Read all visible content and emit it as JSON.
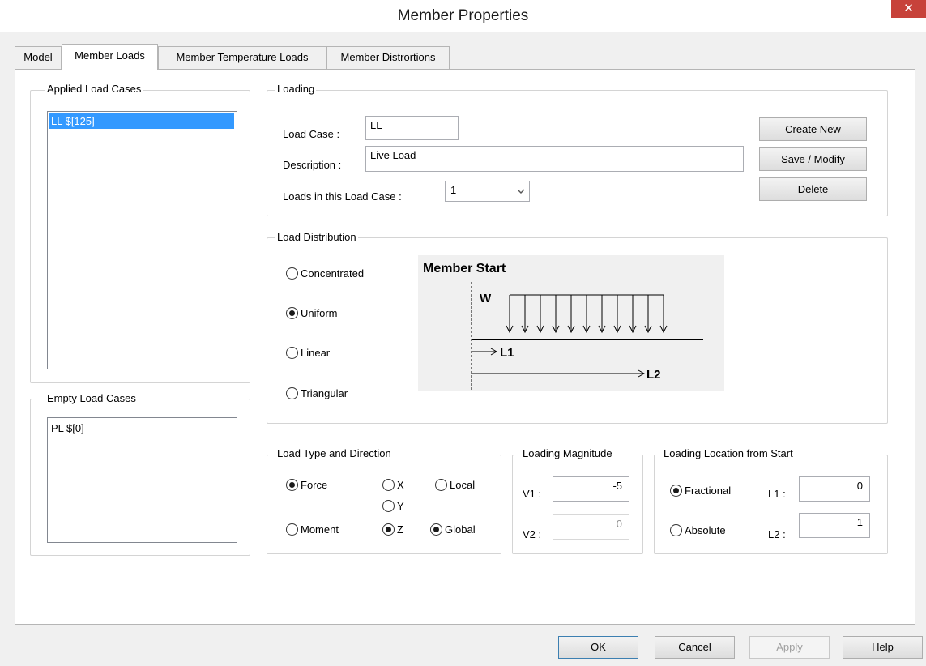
{
  "window": {
    "title": "Member Properties",
    "close_glyph": "✕"
  },
  "tabs": [
    {
      "label": "Model",
      "active": false
    },
    {
      "label": "Member Loads",
      "active": true
    },
    {
      "label": "Member Temperature Loads",
      "active": false
    },
    {
      "label": "Member Distrortions",
      "active": false
    }
  ],
  "applied_load_cases": {
    "label": "Applied Load Cases",
    "items": [
      "LL $[125]"
    ],
    "selected_index": 0
  },
  "empty_load_cases": {
    "label": "Empty Load Cases",
    "items": [
      "PL $[0]"
    ]
  },
  "loading": {
    "label": "Loading",
    "load_case_label": "Load Case :",
    "load_case_value": "LL",
    "description_label": "Description :",
    "description_value": "Live Load",
    "loads_in_case_label": "Loads in this Load Case :",
    "loads_in_case_value": "1",
    "buttons": {
      "create_new": "Create New",
      "save_modify": "Save / Modify",
      "delete": "Delete"
    }
  },
  "load_distribution": {
    "label": "Load Distribution",
    "options": [
      "Concentrated",
      "Uniform",
      "Linear",
      "Triangular"
    ],
    "selected": "Uniform",
    "diagram": {
      "title": "Member Start",
      "w_label": "W",
      "l1_label": "L1",
      "l2_label": "L2"
    }
  },
  "load_type": {
    "label": "Load Type and Direction",
    "types": [
      "Force",
      "Moment"
    ],
    "selected_type": "Force",
    "directions": [
      "X",
      "Y",
      "Z"
    ],
    "selected_direction": "Z",
    "systems": [
      "Local",
      "Global"
    ],
    "selected_system": "Global"
  },
  "magnitude": {
    "label": "Loading Magnitude",
    "v1_label": "V1 :",
    "v1_value": "-5",
    "v2_label": "V2 :",
    "v2_value": "0"
  },
  "location": {
    "label": "Loading Location from Start",
    "modes": [
      "Fractional",
      "Absolute"
    ],
    "selected_mode": "Fractional",
    "l1_label": "L1 :",
    "l1_value": "0",
    "l2_label": "L2 :",
    "l2_value": "1"
  },
  "footer": {
    "ok": "OK",
    "cancel": "Cancel",
    "apply": "Apply",
    "help": "Help"
  },
  "colors": {
    "selection": "#3399ff",
    "close_button": "#c7423a",
    "default_button_border": "#3c7fb1"
  }
}
